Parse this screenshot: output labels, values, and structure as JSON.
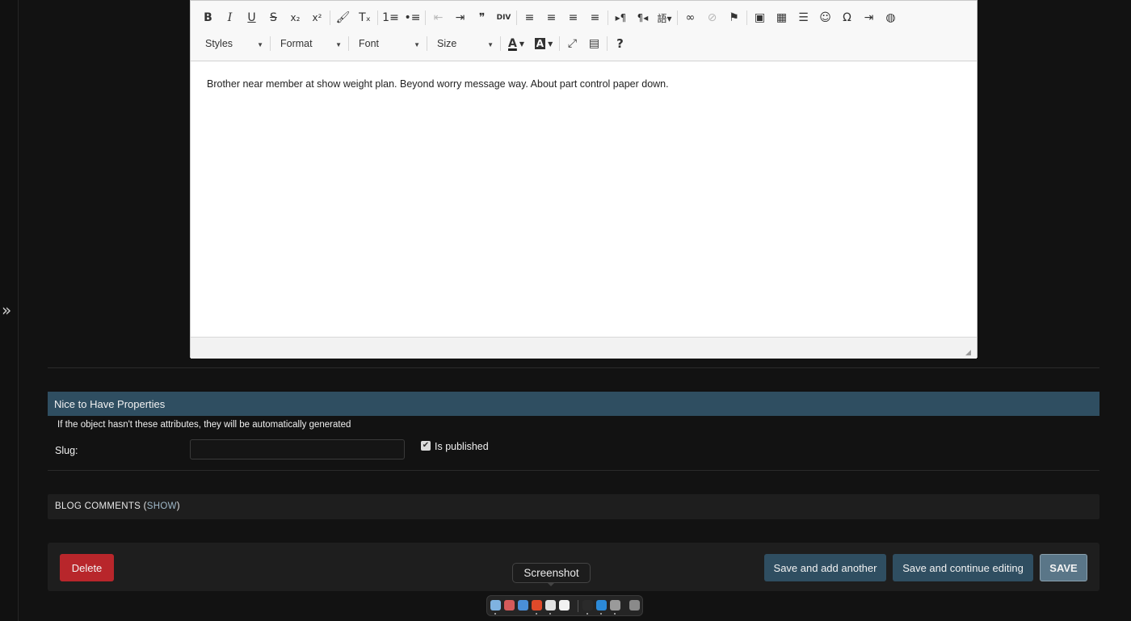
{
  "sidebar": {
    "toggle_glyph": "»"
  },
  "editor": {
    "toolbar_row1": [
      {
        "name": "bold-button",
        "glyph": "B"
      },
      {
        "name": "italic-button",
        "glyph": "I"
      },
      {
        "name": "underline-button",
        "glyph": "U"
      },
      {
        "name": "strikethrough-button",
        "glyph": "S"
      },
      {
        "name": "subscript-button",
        "glyph": "x₂"
      },
      {
        "name": "superscript-button",
        "glyph": "x²"
      },
      {
        "name": "copy-formatting-button",
        "glyph": "🖌"
      },
      {
        "name": "remove-format-button",
        "glyph": "Tₓ"
      },
      {
        "name": "numbered-list-button",
        "glyph": "1≡"
      },
      {
        "name": "bulleted-list-button",
        "glyph": "•≡"
      },
      {
        "name": "decrease-indent-button",
        "glyph": "⇤"
      },
      {
        "name": "increase-indent-button",
        "glyph": "⇥"
      },
      {
        "name": "blockquote-button",
        "glyph": "❞"
      },
      {
        "name": "create-div-button",
        "glyph": "DIV"
      },
      {
        "name": "align-left-button",
        "glyph": "≡"
      },
      {
        "name": "align-center-button",
        "glyph": "≡"
      },
      {
        "name": "align-right-button",
        "glyph": "≡"
      },
      {
        "name": "justify-button",
        "glyph": "≡"
      },
      {
        "name": "ltr-button",
        "glyph": "▸¶"
      },
      {
        "name": "rtl-button",
        "glyph": "¶◂"
      },
      {
        "name": "language-button",
        "glyph": "語▾"
      },
      {
        "name": "link-button",
        "glyph": "∞"
      },
      {
        "name": "unlink-button",
        "glyph": "⊘"
      },
      {
        "name": "anchor-button",
        "glyph": "⚑"
      },
      {
        "name": "image-button",
        "glyph": "▣"
      },
      {
        "name": "table-button",
        "glyph": "▦"
      },
      {
        "name": "horizontal-line-button",
        "glyph": "☰"
      },
      {
        "name": "smiley-button",
        "glyph": "☺"
      },
      {
        "name": "special-char-button",
        "glyph": "Ω"
      },
      {
        "name": "page-break-button",
        "glyph": "⇥"
      },
      {
        "name": "iframe-button",
        "glyph": "◍"
      }
    ],
    "combos": {
      "styles": "Styles",
      "format": "Format",
      "font": "Font",
      "size": "Size"
    },
    "text_color_glyph": "A",
    "bg_color_glyph": "A",
    "maximize_glyph": "⤢",
    "show_blocks_glyph": "▤",
    "help_glyph": "?",
    "content": "Brother near member at show weight plan. Beyond worry message way. About part control paper down."
  },
  "nice_to_have": {
    "header": "Nice to Have Properties",
    "description": "If the object hasn't these attributes, they will be automatically generated",
    "slug_label": "Slug:",
    "slug_value": "",
    "is_published_label": "Is published",
    "is_published_checked": true
  },
  "comments": {
    "title": "BLOG COMMENTS",
    "open_paren": " (",
    "show_link": "SHOW",
    "close_paren": ")"
  },
  "actions": {
    "delete": "Delete",
    "save_add": "Save and add another",
    "save_continue": "Save and continue editing",
    "save": "SAVE"
  },
  "dock": {
    "tooltip": "Screenshot",
    "icons": [
      {
        "name": "finder-icon",
        "color": "#7fb2e0",
        "dot": true
      },
      {
        "name": "launchpad-icon",
        "color": "#d45a5a",
        "dot": false
      },
      {
        "name": "safari-icon",
        "color": "#4a8fd8",
        "dot": false
      },
      {
        "name": "brave-icon",
        "color": "#e04a2a",
        "dot": true
      },
      {
        "name": "chrome-icon",
        "color": "#e0e0e0",
        "dot": true
      },
      {
        "name": "notion-icon",
        "color": "#f2f2f2",
        "dot": false
      },
      {
        "name": "terminal-icon",
        "color": "#2a2a2a",
        "dot": true
      },
      {
        "name": "vscode-icon",
        "color": "#2c8ad8",
        "dot": true
      },
      {
        "name": "spotify-icon",
        "color": "#9a9a9a",
        "dot": true
      },
      {
        "name": "trash-icon",
        "color": "#8a8a8a",
        "dot": false
      }
    ]
  }
}
